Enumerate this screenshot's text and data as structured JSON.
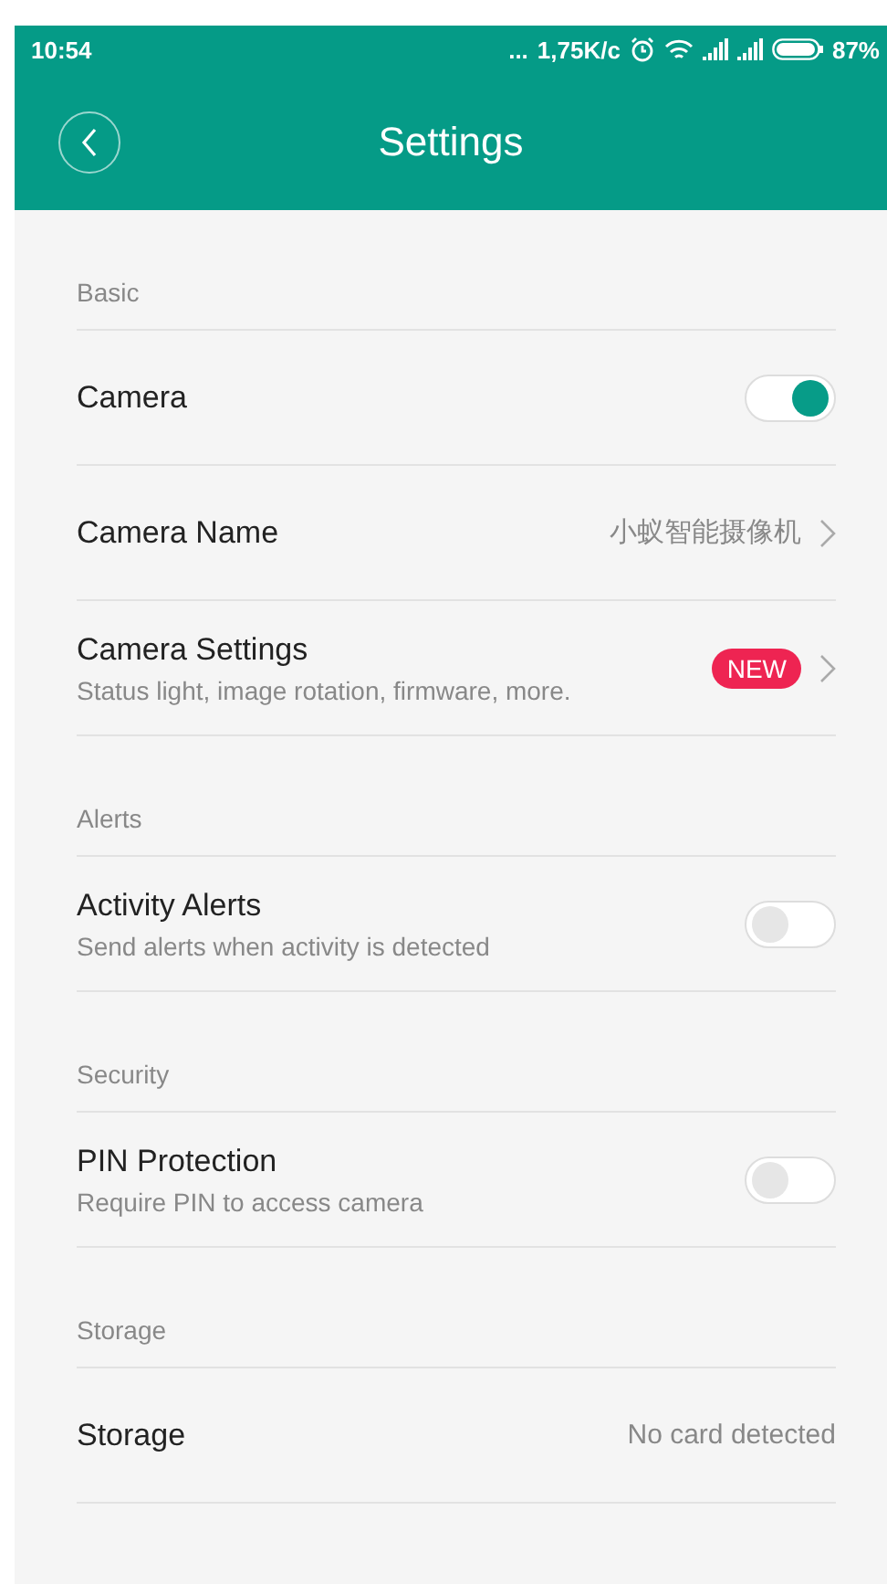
{
  "status_bar": {
    "time": "10:54",
    "dots": "...",
    "speed": "1,75K/c",
    "battery": "87%"
  },
  "header": {
    "title": "Settings"
  },
  "sections": [
    {
      "title": "Basic",
      "items": [
        {
          "kind": "toggle",
          "label": "Camera",
          "on": true
        },
        {
          "kind": "link",
          "label": "Camera Name",
          "value": "小蚁智能摄像机"
        },
        {
          "kind": "link",
          "label": "Camera Settings",
          "subtitle": "Status light, image rotation, firmware, more.",
          "badge": "NEW"
        }
      ]
    },
    {
      "title": "Alerts",
      "items": [
        {
          "kind": "toggle",
          "label": "Activity Alerts",
          "subtitle": "Send alerts when activity is detected",
          "on": false
        }
      ]
    },
    {
      "title": "Security",
      "items": [
        {
          "kind": "toggle",
          "label": "PIN Protection",
          "subtitle": "Require PIN to access camera",
          "on": false
        }
      ]
    },
    {
      "title": "Storage",
      "items": [
        {
          "kind": "value",
          "label": "Storage",
          "value": "No card detected"
        }
      ]
    }
  ]
}
